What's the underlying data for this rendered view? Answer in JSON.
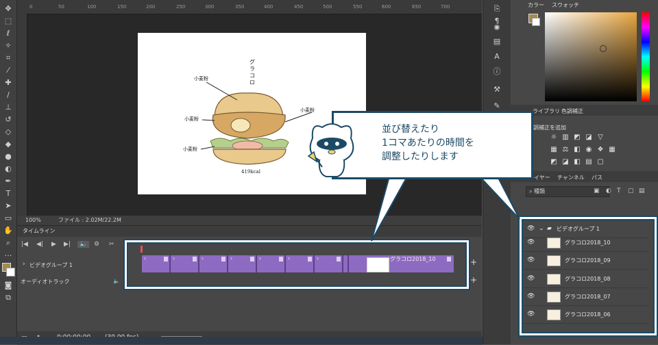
{
  "status": {
    "zoom": "100%",
    "file": "ファイル : 2.02M/22.2M"
  },
  "document": {
    "title_vertical": "グラコロ",
    "labels": [
      "小麦粉",
      "小麦粉",
      "小麦粉",
      "小麦粉"
    ],
    "kcal": "419kcal"
  },
  "ruler": {
    "ticks": [
      "0",
      "50",
      "100",
      "150",
      "200",
      "250",
      "300",
      "350",
      "400",
      "450",
      "500",
      "550",
      "600",
      "650",
      "700"
    ]
  },
  "timeline": {
    "tab": "タイムライン",
    "video_group": "ビデオグループ 1",
    "audio_track": "オーディオトラック",
    "last_clip_label": "グラコロ2018_10",
    "timecode": "0:00:00:00",
    "fps": "(30.00 fps)"
  },
  "color_panel": {
    "tab_color": "カラー",
    "tab_swatch": "スウォッチ"
  },
  "adjust_panel": {
    "tab_library": "ライブラリ",
    "tab_adjust": "色調補正",
    "add_label": "調補正を追加"
  },
  "layers_panel": {
    "tab_layers": "レイヤー",
    "tab_channels": "チャンネル",
    "tab_paths": "パス",
    "filter_kind": "種類",
    "group": "ビデオグループ 1",
    "layers": [
      "グラコロ2018_10",
      "グラコロ2018_09",
      "グラコロ2018_08",
      "グラコロ2018_07",
      "グラコロ2018_06"
    ]
  },
  "callout": {
    "lines": [
      "並び替えたり",
      "1コマあたりの時間を",
      "調整したりします"
    ]
  },
  "colors": {
    "accent": "#1b4a66",
    "clip": "#8e6bc2",
    "panel": "#474747"
  }
}
